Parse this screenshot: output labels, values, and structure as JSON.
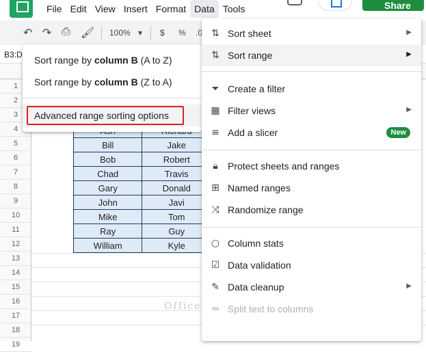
{
  "menubar": {
    "items": [
      "File",
      "Edit",
      "View",
      "Insert",
      "Format",
      "Data",
      "Tools"
    ],
    "active": "Data",
    "share_label": "Share"
  },
  "toolbar": {
    "zoom": "100%",
    "currency": "$",
    "percent": "%",
    "decimal": ".0"
  },
  "formula_bar": {
    "name_box": "B3:D"
  },
  "grid": {
    "row_numbers": [
      "1",
      "2",
      "3",
      "4",
      "5",
      "6",
      "7",
      "8",
      "9",
      "10",
      "11",
      "12",
      "13",
      "14",
      "15",
      "16",
      "17",
      "18",
      "19"
    ],
    "table_rows": [
      [
        "Ash",
        "Richard"
      ],
      [
        "Bill",
        "Jake"
      ],
      [
        "Bob",
        "Robert"
      ],
      [
        "Chad",
        "Travis"
      ],
      [
        "Gary",
        "Donald"
      ],
      [
        "John",
        "Javi"
      ],
      [
        "Mike",
        "Tom"
      ],
      [
        "Ray",
        "Guy"
      ],
      [
        "William",
        "Kyle"
      ]
    ]
  },
  "submenu": {
    "item1_prefix": "Sort range by ",
    "item1_bold": "column B",
    "item1_suffix": " (A to Z)",
    "item2_prefix": "Sort range by ",
    "item2_bold": "column B",
    "item2_suffix": " (Z to A)",
    "advanced": "Advanced range sorting options"
  },
  "data_menu": {
    "sort_sheet": "Sort sheet",
    "sort_range": "Sort range",
    "create_filter": "Create a filter",
    "filter_views": "Filter views",
    "add_slicer": "Add a slicer",
    "new_badge": "New",
    "protect": "Protect sheets and ranges",
    "named_ranges": "Named ranges",
    "randomize": "Randomize range",
    "column_stats": "Column stats",
    "data_validation": "Data validation",
    "data_cleanup": "Data cleanup",
    "split_text": "Split text to columns"
  },
  "watermark": "OfficeWheel",
  "colors": {
    "accent_green": "#1e8e3e",
    "highlight": "#e02020",
    "table_fill": "#deebf7",
    "table_border": "#1f3864"
  }
}
